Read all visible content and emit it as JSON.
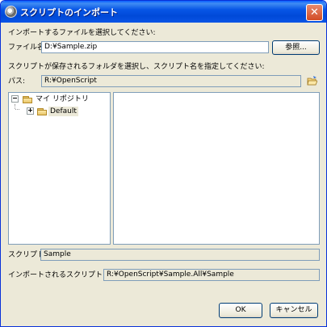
{
  "window": {
    "title": "スクリプトのインポート"
  },
  "import_file": {
    "heading": "インポートするファイルを選択してください:",
    "label": "ファイル名:",
    "value": "D:¥Sample.zip",
    "browse_label": "参照..."
  },
  "location": {
    "heading": "スクリプトが保存されるフォルダを選択し、スクリプト名を指定してください:",
    "path_label": "パス:",
    "path_value": "R:¥OpenScript"
  },
  "tree": {
    "root": {
      "label": "マイ リポジトリ",
      "expander": "⊟"
    },
    "children": [
      {
        "label": "Default",
        "expander": "⊞"
      }
    ]
  },
  "script": {
    "label": "スクリプト:",
    "value": "Sample"
  },
  "imported_path": {
    "label": "インポートされるスクリプト パス:",
    "value": "R:¥OpenScript¥Sample.All¥Sample"
  },
  "buttons": {
    "ok": "OK",
    "cancel": "キャンセル"
  },
  "icons": {
    "title": "app-icon",
    "close": "close-icon",
    "open_folder": "open-folder-icon",
    "folder": "folder-icon"
  }
}
